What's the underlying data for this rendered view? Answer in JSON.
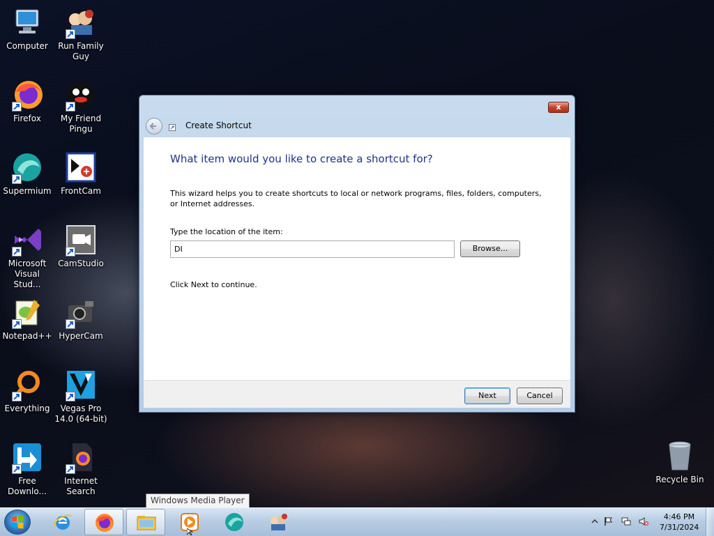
{
  "desktop": {
    "icons": [
      {
        "label": "Computer"
      },
      {
        "label": "Run Family Guy"
      },
      {
        "label": "Firefox"
      },
      {
        "label": "My Friend Pingu"
      },
      {
        "label": "Supermium"
      },
      {
        "label": "FrontCam"
      },
      {
        "label": "Microsoft Visual Stud..."
      },
      {
        "label": "CamStudio"
      },
      {
        "label": "Notepad++"
      },
      {
        "label": "HyperCam"
      },
      {
        "label": "Everything"
      },
      {
        "label": "Vegas Pro 14.0 (64-bit)"
      },
      {
        "label": "Free Downlo..."
      },
      {
        "label": "Internet Search"
      },
      {
        "label": "Recycle Bin"
      }
    ]
  },
  "dialog": {
    "title": "Create Shortcut",
    "close_glyph": "x",
    "heading": "What item would you like to create a shortcut for?",
    "description": "This wizard helps you to create shortcuts to local or network programs, files, folders, computers, or Internet addresses.",
    "location_label": "Type the location of the item:",
    "location_value": "DI",
    "browse_label": "Browse...",
    "continue_text": "Click Next to continue.",
    "next_label": "Next",
    "cancel_label": "Cancel"
  },
  "tooltip": {
    "text": "Windows Media Player"
  },
  "taskbar": {
    "pinned": [
      "internet-explorer-icon",
      "firefox-icon",
      "file-explorer-icon",
      "windows-media-player-icon",
      "supermium-icon",
      "family-guy-icon"
    ],
    "clock": {
      "time": "4:46 PM",
      "date": "7/31/2024"
    }
  },
  "colors": {
    "heading": "#1e3287",
    "taskbar": "#b8cde3",
    "accent": "#3c7fb1"
  }
}
